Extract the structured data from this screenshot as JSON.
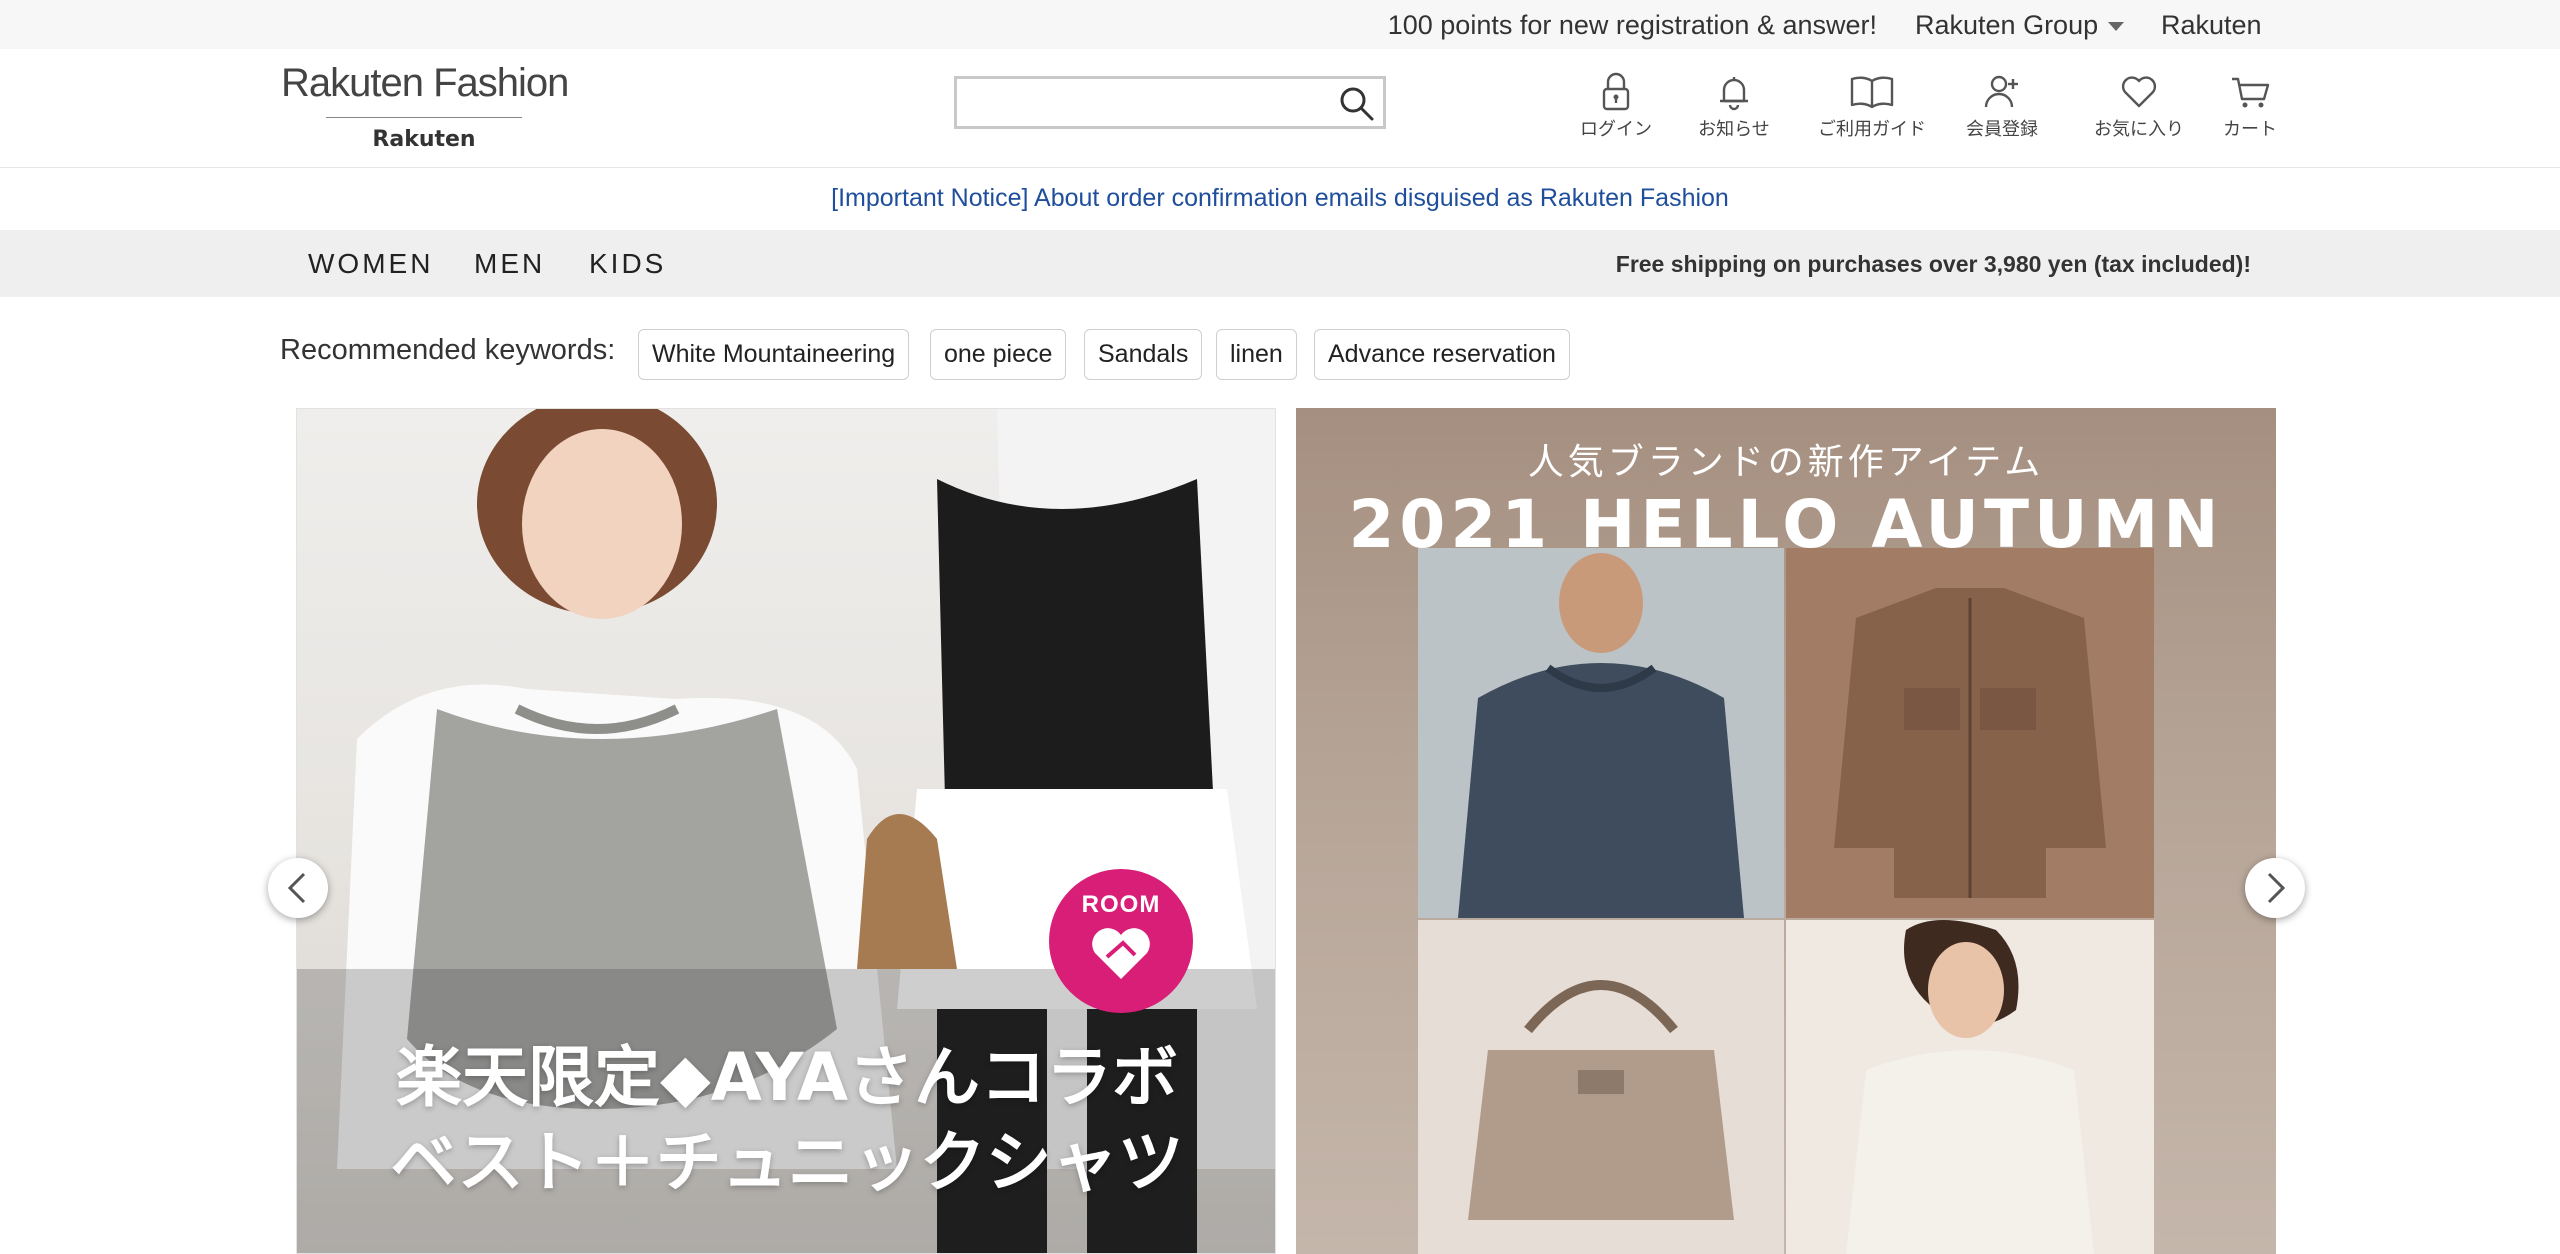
{
  "topbar": {
    "promo": "100 points for new registration & answer!",
    "group": "Rakuten Group",
    "rakuten": "Rakuten"
  },
  "header": {
    "logo_top": "Rakuten Fashion",
    "logo_bottom": "Rakuten",
    "search_placeholder": "",
    "icons": [
      {
        "name": "login",
        "label": "ログイン",
        "icon": "lock-icon"
      },
      {
        "name": "notice",
        "label": "お知らせ",
        "icon": "bell-icon"
      },
      {
        "name": "guide",
        "label": "ご利用ガイド",
        "icon": "book-icon"
      },
      {
        "name": "register",
        "label": "会員登録",
        "icon": "user-plus-icon"
      },
      {
        "name": "favorites",
        "label": "お気に入り",
        "icon": "heart-icon"
      },
      {
        "name": "cart",
        "label": "カート",
        "icon": "cart-icon"
      }
    ]
  },
  "notice": "[Important Notice] About order confirmation emails disguised as Rakuten Fashion",
  "categories": [
    "WOMEN",
    "MEN",
    "KIDS"
  ],
  "shipping": "Free shipping on purchases over 3,980 yen (tax included)!",
  "keywords": {
    "label": "Recommended keywords:",
    "items": [
      "White Mountaineering",
      "one piece",
      "Sandals",
      "linen",
      "Advance reservation"
    ]
  },
  "banners": [
    {
      "line1": "楽天限定◆AYAさんコラボ",
      "line2": "ベスト＋チュニックシャツ",
      "badge": "ROOM"
    },
    {
      "subtitle": "人気ブランドの新作アイテム",
      "title": "2021 HELLO AUTUMN"
    }
  ],
  "colors": {
    "link": "#1f4e9c",
    "room_badge": "#d81e76",
    "topbar_bg": "#f7f7f7",
    "catbar_bg": "#efefef"
  }
}
